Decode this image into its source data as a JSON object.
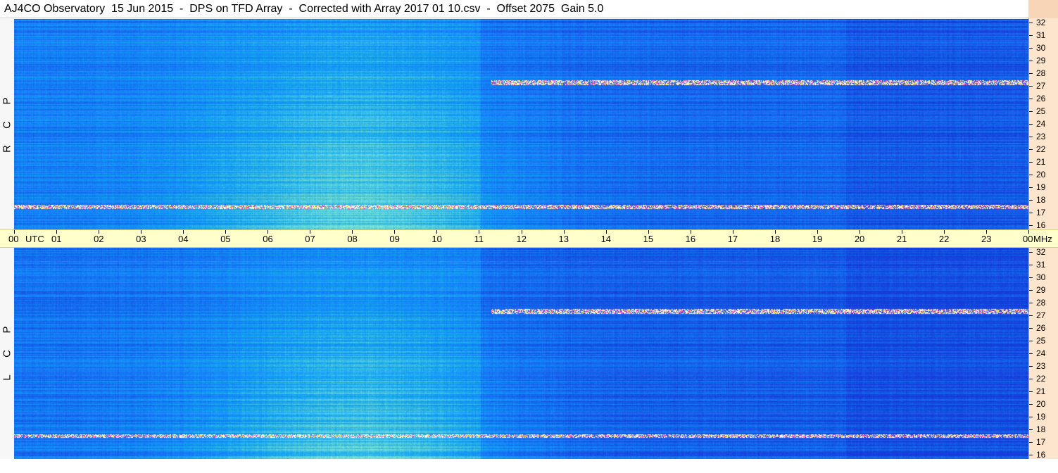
{
  "window": {
    "title": "AJ4CO Observatory  15 Jun 2015  -  DPS on TFD Array  -  Corrected with Array 2017 01 10.csv  -  Offset 2075  Gain 5.0"
  },
  "panels": [
    {
      "name": "rcp",
      "side_label": [
        "R",
        "C",
        "P"
      ]
    },
    {
      "name": "lcp",
      "side_label": [
        "L",
        "C",
        "P"
      ]
    }
  ],
  "time_axis": {
    "labels": [
      "00",
      "UTC",
      "01",
      "02",
      "03",
      "04",
      "05",
      "06",
      "07",
      "08",
      "09",
      "10",
      "11",
      "12",
      "13",
      "14",
      "15",
      "16",
      "17",
      "18",
      "19",
      "20",
      "21",
      "22",
      "23",
      "00",
      "MHz"
    ]
  },
  "freq_axis": {
    "labels": [
      "32",
      "31",
      "30",
      "29",
      "28",
      "27",
      "26",
      "25",
      "24",
      "23",
      "22",
      "21",
      "20",
      "19",
      "18",
      "17",
      "16"
    ],
    "range_mhz": [
      16,
      32
    ]
  },
  "colors": {
    "axis_bg": "#ffffcc",
    "freq_axis_bg": "#fde4cc",
    "spectrum_low": "#0a2a9a",
    "spectrum_mid": "#1a7ae8",
    "spectrum_high": "#2ee0c8"
  }
}
